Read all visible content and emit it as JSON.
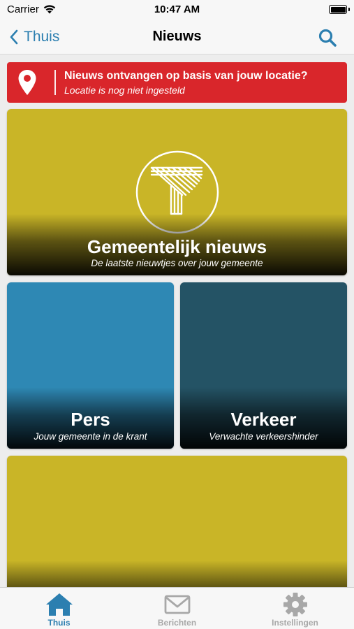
{
  "status_bar": {
    "carrier": "Carrier",
    "time": "10:47 AM"
  },
  "nav": {
    "back_label": "Thuis",
    "title": "Nieuws"
  },
  "banner": {
    "title": "Nieuws ontvangen op basis van jouw locatie?",
    "subtitle": "Locatie is nog niet ingesteld",
    "color": "#d9262b"
  },
  "tiles": [
    {
      "title": "Gemeentelijk nieuws",
      "subtitle": "De laatste nieuwtjes over jouw gemeente",
      "color": "#c9b527"
    },
    {
      "title": "Pers",
      "subtitle": "Jouw gemeente in de krant",
      "color": "#2e88b4"
    },
    {
      "title": "Verkeer",
      "subtitle": "Verwachte verkeershinder",
      "color": "#245365"
    },
    {
      "title": "",
      "subtitle": "",
      "color": "#c9b527"
    }
  ],
  "tab_bar": {
    "items": [
      {
        "label": "Thuis",
        "icon": "home-icon",
        "active": true
      },
      {
        "label": "Berichten",
        "icon": "envelope-icon",
        "active": false
      },
      {
        "label": "Instellingen",
        "icon": "gear-icon",
        "active": false
      }
    ],
    "active_color": "#2c7fb0",
    "inactive_color": "#a8a8a8"
  },
  "accent_color": "#2c7fb0"
}
